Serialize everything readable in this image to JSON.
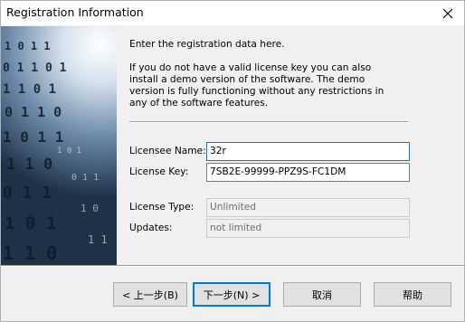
{
  "window": {
    "title": "Registration Information"
  },
  "intro": {
    "line1": "Enter the registration data here.",
    "line2": "If you do not have a valid license key you can also install a demo version of the software. The demo version is fully functioning without any restrictions in any of the software features."
  },
  "fields": {
    "licensee_name_label": "Licensee Name:",
    "licensee_name_value": "32r",
    "license_key_label": "License Key:",
    "license_key_value": "7SB2E-99999-PPZ9S-FC1DM",
    "license_type_label": "License Type:",
    "license_type_value": "Unlimited",
    "updates_label": "Updates:",
    "updates_value": "not limited"
  },
  "buttons": {
    "back": "< 上一步(B)",
    "next": "下一步(N) >",
    "cancel": "取消",
    "help": "帮助"
  },
  "colors": {
    "focus_border": "#0078d7",
    "side_image_base": "#2e4155"
  },
  "icons": {
    "close": "close-icon"
  }
}
